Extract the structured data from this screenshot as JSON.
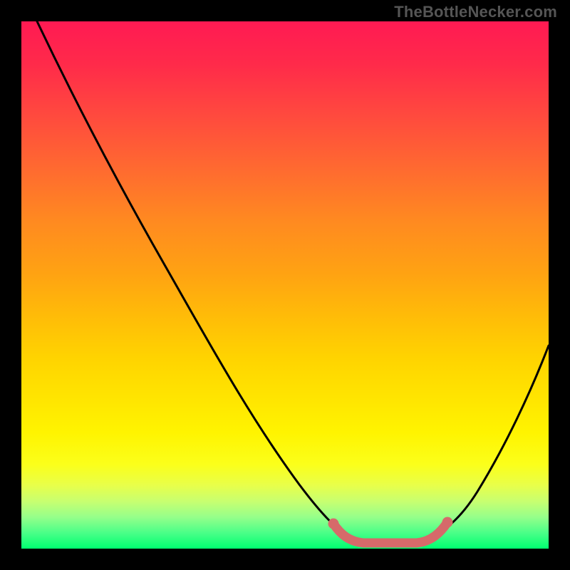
{
  "watermark": "TheBottleNecker.com",
  "chart_data": {
    "type": "line",
    "title": "",
    "xlabel": "",
    "ylabel": "",
    "xlim": [
      0,
      100
    ],
    "ylim": [
      0,
      100
    ],
    "gradient": {
      "top_color": "#ff1a53",
      "bottom_color": "#00ff70",
      "description": "vertical red→orange→yellow→green gradient; red high bottleneck, green low"
    },
    "series": [
      {
        "name": "bottleneck-curve",
        "description": "V-shaped bottleneck curve; minimum around x≈70",
        "x": [
          3,
          10,
          20,
          30,
          40,
          50,
          58,
          62,
          66,
          70,
          74,
          78,
          82,
          90,
          100
        ],
        "y": [
          100,
          88,
          72,
          56,
          40,
          24,
          12,
          6,
          2,
          0,
          0,
          2,
          6,
          20,
          44
        ]
      }
    ],
    "optimal_region": {
      "x_start": 60,
      "x_end": 80,
      "y": 0,
      "label": "marked optimal zone at curve bottom"
    }
  }
}
